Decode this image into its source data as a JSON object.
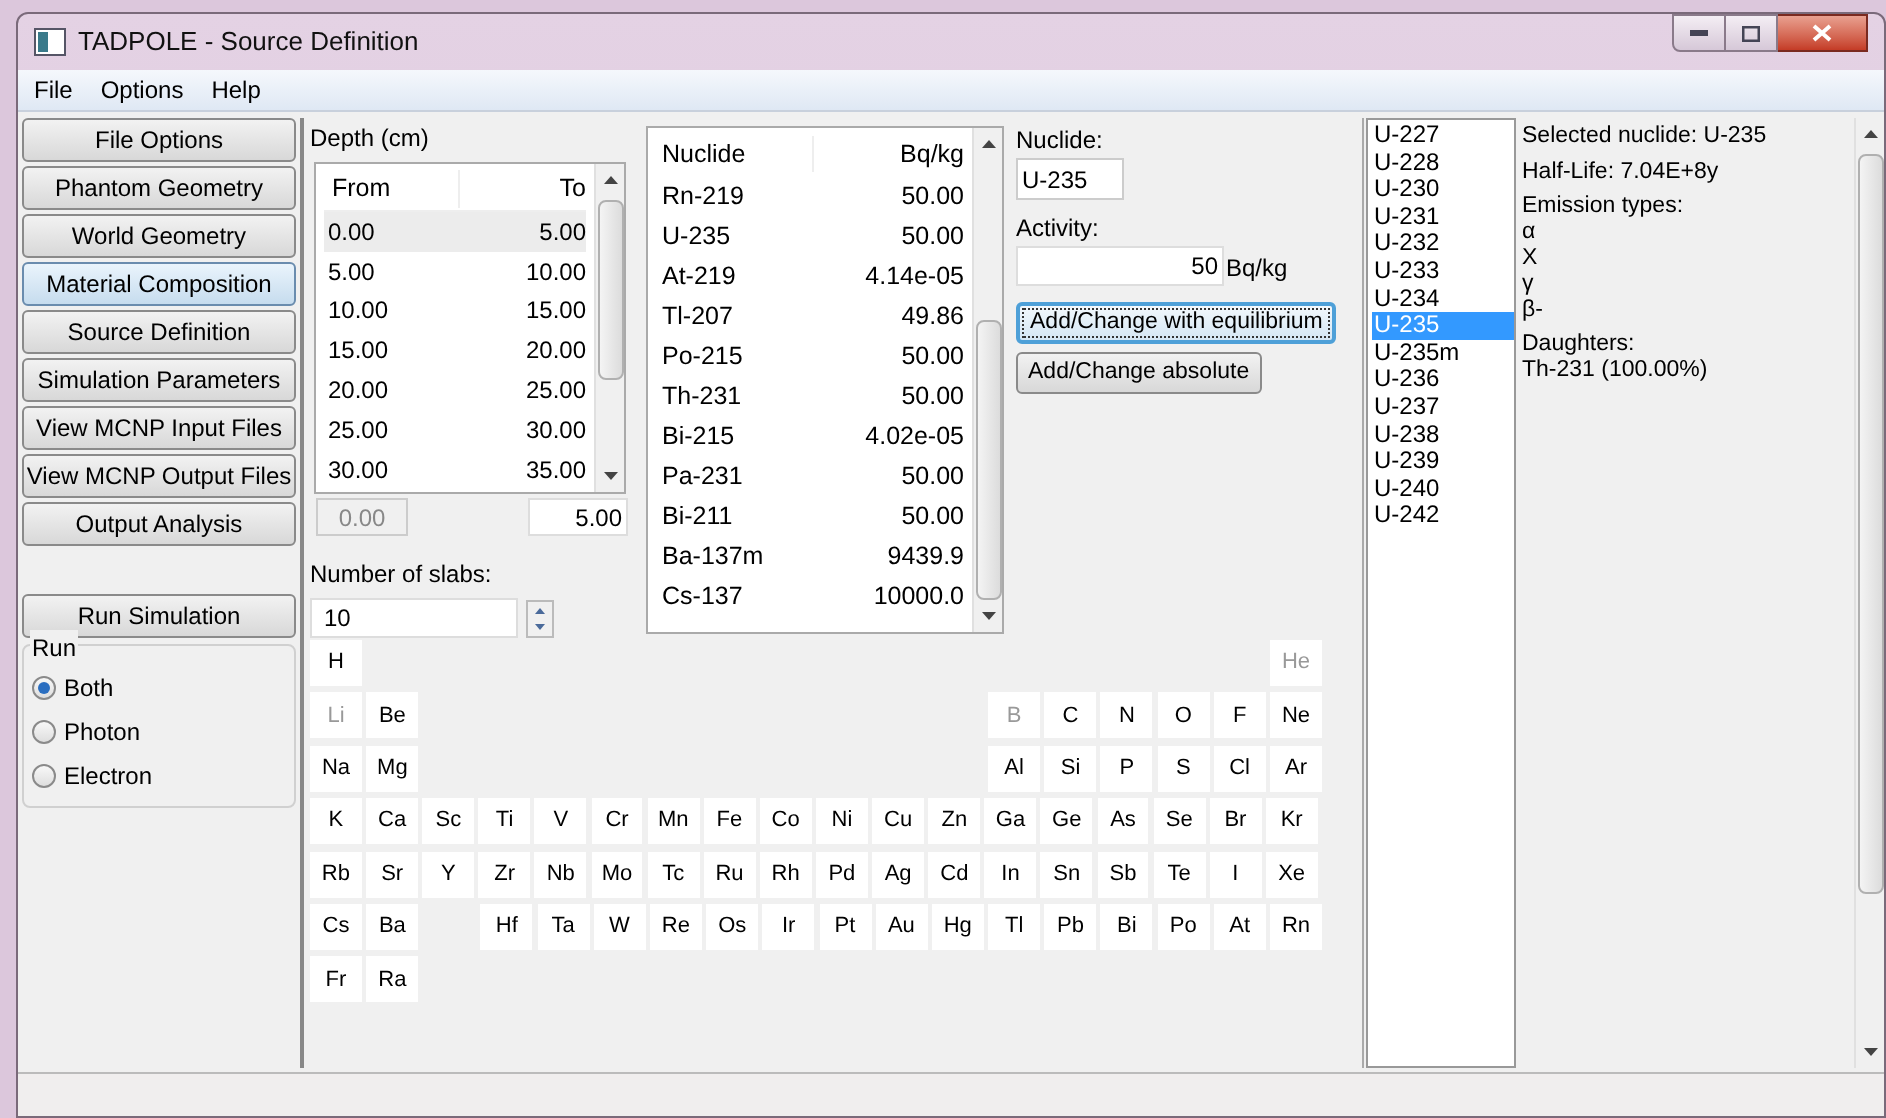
{
  "window": {
    "title": "TADPOLE - Source Definition"
  },
  "menu": [
    "File",
    "Options",
    "Help"
  ],
  "nav_buttons": [
    {
      "label": "File Options",
      "highlighted": false
    },
    {
      "label": "Phantom Geometry",
      "highlighted": false
    },
    {
      "label": "World Geometry",
      "highlighted": false
    },
    {
      "label": "Material Composition",
      "highlighted": true
    },
    {
      "label": "Source Definition",
      "highlighted": false
    },
    {
      "label": "Simulation Parameters",
      "highlighted": false
    },
    {
      "label": "View MCNP Input Files",
      "highlighted": false
    },
    {
      "label": "View MCNP Output Files",
      "highlighted": false
    },
    {
      "label": "Output Analysis",
      "highlighted": false
    }
  ],
  "run_button": "Run Simulation",
  "run_group": {
    "title": "Run",
    "options": [
      {
        "label": "Both",
        "selected": true
      },
      {
        "label": "Photon",
        "selected": false
      },
      {
        "label": "Electron",
        "selected": false
      }
    ]
  },
  "depth": {
    "label": "Depth (cm)",
    "columns": [
      "From",
      "To"
    ],
    "rows": [
      {
        "from": "0.00",
        "to": "5.00",
        "selected": true
      },
      {
        "from": "5.00",
        "to": "10.00",
        "selected": false
      },
      {
        "from": "10.00",
        "to": "15.00",
        "selected": false
      },
      {
        "from": "15.00",
        "to": "20.00",
        "selected": false
      },
      {
        "from": "20.00",
        "to": "25.00",
        "selected": false
      },
      {
        "from": "25.00",
        "to": "30.00",
        "selected": false
      },
      {
        "from": "30.00",
        "to": "35.00",
        "selected": false
      }
    ],
    "from_field": {
      "value": "0.00",
      "disabled": true
    },
    "to_field": {
      "value": "5.00",
      "disabled": false
    },
    "slabs_label": "Number of slabs:",
    "slabs_value": "10"
  },
  "nuclide_table": {
    "columns": [
      "Nuclide",
      "Bq/kg"
    ],
    "rows": [
      {
        "nuclide": "Rn-219",
        "activity": "50.00"
      },
      {
        "nuclide": "U-235",
        "activity": "50.00"
      },
      {
        "nuclide": "At-219",
        "activity": "4.14e-05"
      },
      {
        "nuclide": "Tl-207",
        "activity": "49.86"
      },
      {
        "nuclide": "Po-215",
        "activity": "50.00"
      },
      {
        "nuclide": "Th-231",
        "activity": "50.00"
      },
      {
        "nuclide": "Bi-215",
        "activity": "4.02e-05"
      },
      {
        "nuclide": "Pa-231",
        "activity": "50.00"
      },
      {
        "nuclide": "Bi-211",
        "activity": "50.00"
      },
      {
        "nuclide": "Ba-137m",
        "activity": "9439.9"
      },
      {
        "nuclide": "Cs-137",
        "activity": "10000.0"
      }
    ]
  },
  "nuclide_form": {
    "nuclide_label": "Nuclide:",
    "nuclide_value": "U-235",
    "activity_label": "Activity:",
    "activity_value": "50",
    "activity_unit": "Bq/kg",
    "buttons": [
      {
        "label": "Add/Change with equilibrium",
        "focused": true
      },
      {
        "label": "Add/Change absolute",
        "focused": false
      }
    ]
  },
  "periodic_table": [
    {
      "left": [
        {
          "symbol": "H",
          "disabled": false
        }
      ],
      "right": [
        {
          "symbol": "He",
          "disabled": true
        }
      ]
    },
    {
      "left": [
        {
          "symbol": "Li",
          "disabled": true
        },
        {
          "symbol": "Be",
          "disabled": false
        }
      ],
      "right": [
        {
          "symbol": "B",
          "disabled": true
        },
        {
          "symbol": "C",
          "disabled": false
        },
        {
          "symbol": "N",
          "disabled": false
        },
        {
          "symbol": "O",
          "disabled": false
        },
        {
          "symbol": "F",
          "disabled": false
        },
        {
          "symbol": "Ne",
          "disabled": false
        }
      ]
    },
    {
      "left": [
        {
          "symbol": "Na",
          "disabled": false
        },
        {
          "symbol": "Mg",
          "disabled": false
        }
      ],
      "right": [
        {
          "symbol": "Al",
          "disabled": false
        },
        {
          "symbol": "Si",
          "disabled": false
        },
        {
          "symbol": "P",
          "disabled": false
        },
        {
          "symbol": "S",
          "disabled": false
        },
        {
          "symbol": "Cl",
          "disabled": false
        },
        {
          "symbol": "Ar",
          "disabled": false
        }
      ]
    },
    {
      "left": [
        {
          "symbol": "K",
          "disabled": false
        },
        {
          "symbol": "Ca",
          "disabled": false
        },
        {
          "symbol": "Sc",
          "disabled": false
        },
        {
          "symbol": "Ti",
          "disabled": false
        },
        {
          "symbol": "V",
          "disabled": false
        },
        {
          "symbol": "Cr",
          "disabled": false
        },
        {
          "symbol": "Mn",
          "disabled": false
        },
        {
          "symbol": "Fe",
          "disabled": false
        },
        {
          "symbol": "Co",
          "disabled": false
        },
        {
          "symbol": "Ni",
          "disabled": false
        },
        {
          "symbol": "Cu",
          "disabled": false
        },
        {
          "symbol": "Zn",
          "disabled": false
        },
        {
          "symbol": "Ga",
          "disabled": false
        },
        {
          "symbol": "Ge",
          "disabled": false
        },
        {
          "symbol": "As",
          "disabled": false
        },
        {
          "symbol": "Se",
          "disabled": false
        },
        {
          "symbol": "Br",
          "disabled": false
        },
        {
          "symbol": "Kr",
          "disabled": false
        }
      ]
    },
    {
      "left": [
        {
          "symbol": "Rb",
          "disabled": false
        },
        {
          "symbol": "Sr",
          "disabled": false
        },
        {
          "symbol": "Y",
          "disabled": false
        },
        {
          "symbol": "Zr",
          "disabled": false
        },
        {
          "symbol": "Nb",
          "disabled": false
        },
        {
          "symbol": "Mo",
          "disabled": false
        },
        {
          "symbol": "Tc",
          "disabled": false
        },
        {
          "symbol": "Ru",
          "disabled": false
        },
        {
          "symbol": "Rh",
          "disabled": false
        },
        {
          "symbol": "Pd",
          "disabled": false
        },
        {
          "symbol": "Ag",
          "disabled": false
        },
        {
          "symbol": "Cd",
          "disabled": false
        },
        {
          "symbol": "In",
          "disabled": false
        },
        {
          "symbol": "Sn",
          "disabled": false
        },
        {
          "symbol": "Sb",
          "disabled": false
        },
        {
          "symbol": "Te",
          "disabled": false
        },
        {
          "symbol": "I",
          "disabled": false
        },
        {
          "symbol": "Xe",
          "disabled": false
        }
      ]
    },
    {
      "left": [
        {
          "symbol": "Cs",
          "disabled": false
        },
        {
          "symbol": "Ba",
          "disabled": false
        }
      ],
      "right": [
        {
          "symbol": "Hf",
          "disabled": false
        },
        {
          "symbol": "Ta",
          "disabled": false
        },
        {
          "symbol": "W",
          "disabled": false
        },
        {
          "symbol": "Re",
          "disabled": false
        },
        {
          "symbol": "Os",
          "disabled": false
        },
        {
          "symbol": "Ir",
          "disabled": false
        },
        {
          "symbol": "Pt",
          "disabled": false
        },
        {
          "symbol": "Au",
          "disabled": false
        },
        {
          "symbol": "Hg",
          "disabled": false
        },
        {
          "symbol": "Tl",
          "disabled": false
        },
        {
          "symbol": "Pb",
          "disabled": false
        },
        {
          "symbol": "Bi",
          "disabled": false
        },
        {
          "symbol": "Po",
          "disabled": false
        },
        {
          "symbol": "At",
          "disabled": false
        },
        {
          "symbol": "Rn",
          "disabled": false
        }
      ]
    },
    {
      "left": [
        {
          "symbol": "Fr",
          "disabled": false
        },
        {
          "symbol": "Ra",
          "disabled": false
        }
      ]
    }
  ],
  "isotopes": [
    {
      "label": "U-227",
      "selected": false
    },
    {
      "label": "U-228",
      "selected": false
    },
    {
      "label": "U-230",
      "selected": false
    },
    {
      "label": "U-231",
      "selected": false
    },
    {
      "label": "U-232",
      "selected": false
    },
    {
      "label": "U-233",
      "selected": false
    },
    {
      "label": "U-234",
      "selected": false
    },
    {
      "label": "U-235",
      "selected": true
    },
    {
      "label": "U-235m",
      "selected": false
    },
    {
      "label": "U-236",
      "selected": false
    },
    {
      "label": "U-237",
      "selected": false
    },
    {
      "label": "U-238",
      "selected": false
    },
    {
      "label": "U-239",
      "selected": false
    },
    {
      "label": "U-240",
      "selected": false
    },
    {
      "label": "U-242",
      "selected": false
    }
  ],
  "info": {
    "selected_nuclide": "Selected nuclide: U-235",
    "half_life": "Half-Life: 7.04E+8y",
    "emission_heading": "Emission types:",
    "emissions": [
      "α",
      "X",
      "γ",
      "β-"
    ],
    "daughters_heading": "Daughters:",
    "daughters": [
      "Th-231 (100.00%)"
    ]
  }
}
